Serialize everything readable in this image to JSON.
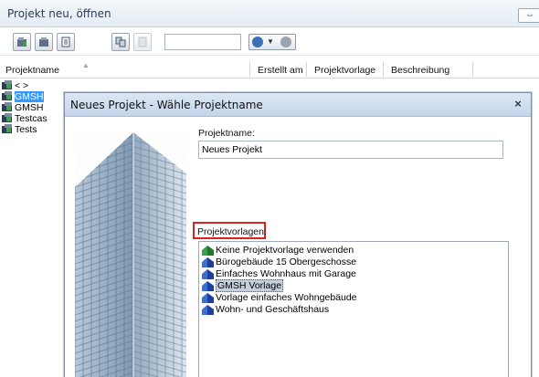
{
  "background_window": {
    "title": "Projekt neu, öffnen",
    "columns": [
      "Projektname",
      "Erstellt am",
      "Projektvorlage",
      "Beschreibung"
    ],
    "tree_items": [
      {
        "label": "< >",
        "selected": false
      },
      {
        "label": "GMSH",
        "selected": true
      },
      {
        "label": "GMSH",
        "selected": false
      },
      {
        "label": "Testcas",
        "selected": false
      },
      {
        "label": "Tests",
        "selected": false
      }
    ]
  },
  "dialog": {
    "title": "Neues Projekt - Wähle Projektname",
    "close_glyph": "×",
    "name_label": "Projektname:",
    "name_value": "Neues Projekt",
    "templates_label": "Projektvorlagen:",
    "templates": [
      {
        "label": "Keine Projektvorlage verwenden",
        "selected": false
      },
      {
        "label": "Bürogebäude 15 Obergeschosse",
        "selected": false
      },
      {
        "label": "Einfaches Wohnhaus mit Garage",
        "selected": false
      },
      {
        "label": "GMSH Vorlage",
        "selected": true
      },
      {
        "label": "Vorlage einfaches Wohngebäude",
        "selected": false
      },
      {
        "label": "Wohn- und Geschäftshaus",
        "selected": false
      }
    ]
  },
  "colors": {
    "highlight_border": "#e0201c",
    "tree_selection": "#3399ff",
    "list_selection": "#c6cfdc"
  }
}
